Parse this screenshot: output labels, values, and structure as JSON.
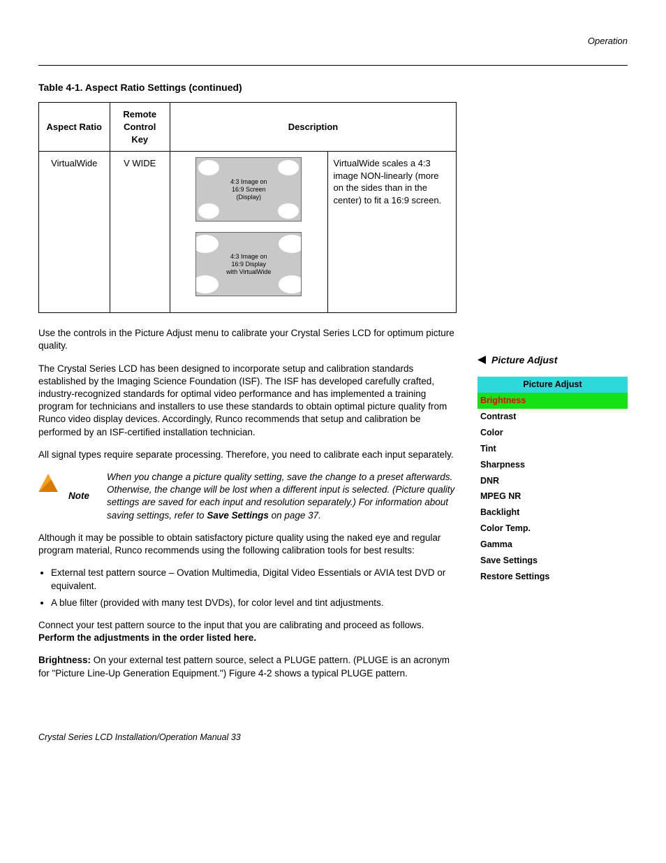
{
  "header": {
    "section": "Operation"
  },
  "table": {
    "title": "Table 4-1. Aspect Ratio Settings (continued)",
    "headers": {
      "c1": "Aspect Ratio",
      "c2": "Remote Control Key",
      "c3": "Description"
    },
    "row": {
      "aspect": "VirtualWide",
      "key": "V WIDE",
      "diagram1": "4:3 Image on\n16:9 Screen (Display)",
      "diagram2": "4:3 Image on\n16:9 Display\nwith VirtualWide",
      "desc": "VirtualWide scales a 4:3 image NON-linearly (more on the sides than in the center) to fit a 16:9 screen."
    }
  },
  "body": {
    "p1": "Use the controls in the Picture Adjust menu to calibrate your Crystal Series LCD for optimum picture quality.",
    "p2": "The Crystal Series LCD has been designed to incorporate setup and calibration standards established by the Imaging Science Foundation (ISF). The ISF has developed carefully crafted, industry-recognized standards for optimal video performance and has implemented a training program for technicians and installers to use these standards to obtain optimal picture quality from Runco video display devices. Accordingly, Runco recommends that setup and calibration be performed by an ISF-certified installation technician.",
    "p3": "All signal types require separate processing. Therefore, you need to calibrate each input separately.",
    "note_label": "Note",
    "note_text_a": "When you change a picture quality setting, save the change to a preset afterwards. Otherwise, the change will be lost when a different input is selected. (Picture quality settings are saved for each input and resolution separately.) For information about saving settings, refer to ",
    "note_text_b": "Save Settings",
    "note_text_c": " on page 37.",
    "p4": "Although it may be possible to obtain satisfactory picture quality using the naked eye and regular program material, Runco recommends using the following calibration tools for best results:",
    "li1": "External test pattern source – Ovation Multimedia, Digital Video Essentials or AVIA test DVD or equivalent.",
    "li2": "A blue filter (provided with many test DVDs), for color level and tint adjustments.",
    "p5a": "Connect your test pattern source to the input that you are calibrating and proceed as follows. ",
    "p5b": "Perform the adjustments in the order listed here.",
    "p6a": "Brightness:",
    "p6b": " On your external test pattern source, select a PLUGE pattern. (PLUGE is an acronym for \"Picture Line-Up Generation Equipment.\") Figure 4-2 shows a typical PLUGE pattern."
  },
  "sidebar": {
    "heading": "Picture Adjust",
    "menu_title": "Picture Adjust",
    "items": [
      "Brightness",
      "Contrast",
      "Color",
      "Tint",
      "Sharpness",
      "DNR",
      "MPEG NR",
      "Backlight",
      "Color Temp.",
      "Gamma",
      "Save Settings",
      "Restore Settings"
    ],
    "selected_index": 0
  },
  "footer": {
    "left": "Crystal Series LCD Installation/Operation Manual",
    "page": "33"
  }
}
